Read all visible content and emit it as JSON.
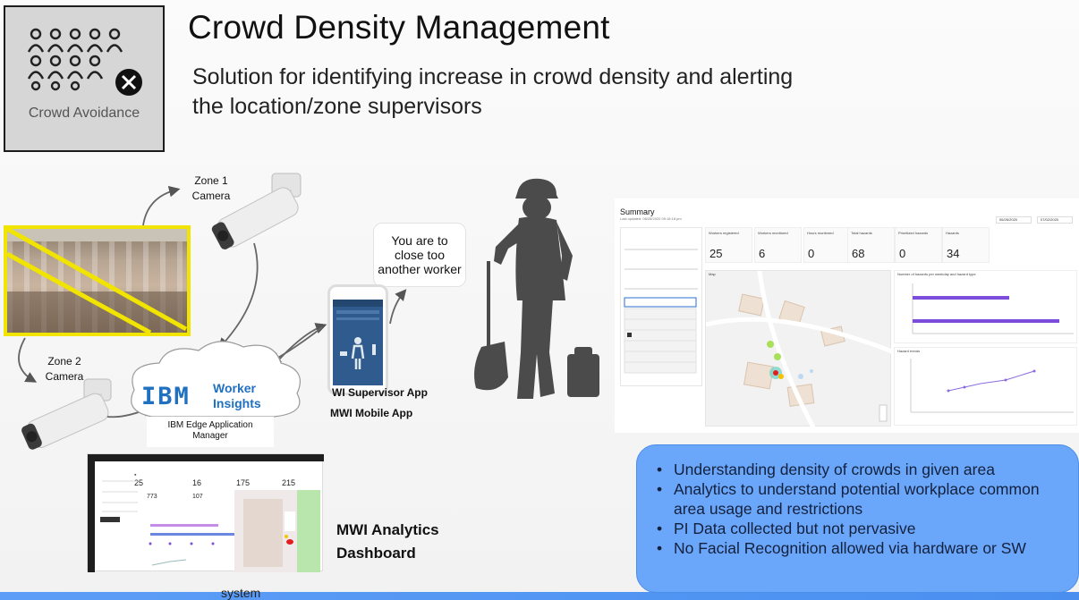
{
  "header": {
    "title": "Crowd Density Management",
    "subtitle": "Solution for identifying increase in crowd density and alerting the location/zone supervisors",
    "logo_caption": "Crowd Avoidance"
  },
  "cameras": {
    "zone1_line1": "Zone 1",
    "zone1_line2": "Camera",
    "zone2_line1": "Zone 2",
    "zone2_line2": "Camera"
  },
  "cloud": {
    "ibm": "IBM",
    "product_line1": "Worker",
    "product_line2": "Insights",
    "edge_line1": "IBM Edge Application",
    "edge_line2": "Manager"
  },
  "bubble": {
    "line1": "You are to",
    "line2": "close too",
    "line3": "another worker"
  },
  "apps": {
    "supervisor": "WI Supervisor App",
    "mobile": "MWI Mobile App"
  },
  "analytics": {
    "label_line1": "MWI Analytics",
    "label_line2": "Dashboard",
    "kpis": [
      "25",
      "16",
      "175",
      "215"
    ],
    "kpis2": [
      "773",
      "107"
    ],
    "cut_text": "system"
  },
  "summary": {
    "title": "Summary",
    "subtitle": "Last updated: 06/28/2020 09:18:18 pm",
    "date_from": "06/26/2020",
    "date_to": "07/02/2020",
    "kpis": [
      {
        "label": "Workers registered",
        "value": "25"
      },
      {
        "label": "Workers monitored",
        "value": "6"
      },
      {
        "label": "Hours monitored",
        "value": "0"
      },
      {
        "label": "Total hazards",
        "value": "68"
      },
      {
        "label": "Prioritized hazards",
        "value": "0"
      },
      {
        "label": "Hazards",
        "value": "34"
      }
    ],
    "map_title": "Map",
    "chart_title": "Number of hazards per weekday and hazard type",
    "trend_title": "Hazard trends"
  },
  "bullets": [
    "Understanding density of crowds in given area",
    "Analytics to understand potential workplace common area usage and restrictions",
    "PI Data collected but not pervasive",
    "No Facial Recognition allowed via hardware or SW"
  ],
  "colors": {
    "ibm_blue": "#1f70c1",
    "bullet_box": "#6aa6fa",
    "photo_frame": "#f1e400",
    "chart_bar": "#7c4ddb"
  }
}
